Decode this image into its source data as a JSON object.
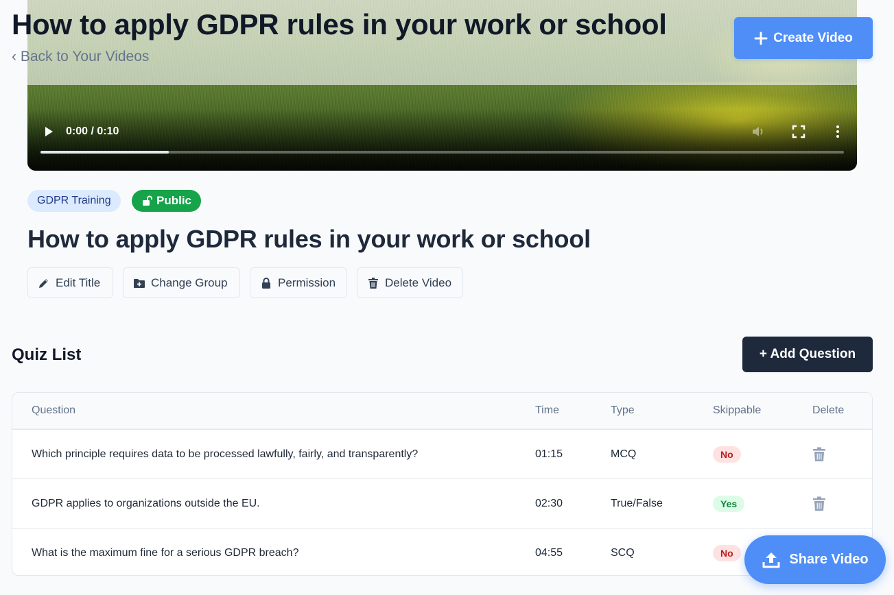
{
  "header": {
    "title": "How to apply GDPR rules in your work or school",
    "back_link": "‹ Back to Your Videos",
    "create_button": "Create Video"
  },
  "video_player": {
    "time": "0:00 / 0:10",
    "progress": 0.16
  },
  "video": {
    "group_badge": "GDPR Training",
    "visibility_badge": "Public",
    "title": "How to apply GDPR rules in your work or school"
  },
  "actions": {
    "edit_title": "Edit Title",
    "change_group": "Change Group",
    "permission": "Permission",
    "delete_video": "Delete Video"
  },
  "quiz": {
    "heading": "Quiz List",
    "add_button": "+ Add Question",
    "columns": [
      "Question",
      "Time",
      "Type",
      "Skippable",
      "Delete"
    ],
    "rows": [
      {
        "question": "Which principle requires data to be processed lawfully, fairly, and transparently?",
        "time": "01:15",
        "type": "MCQ",
        "skippable": "No"
      },
      {
        "question": "GDPR applies to organizations outside the EU.",
        "time": "02:30",
        "type": "True/False",
        "skippable": "Yes"
      },
      {
        "question": "What is the maximum fine for a serious GDPR breach?",
        "time": "04:55",
        "type": "SCQ",
        "skippable": "No"
      }
    ]
  },
  "share_button": "Share Video",
  "colors": {
    "primary": "#4f8ef7",
    "dark": "#1e293b",
    "public_green": "#16a34a",
    "no_bg": "#fee2e2",
    "yes_bg": "#dcfce7"
  }
}
